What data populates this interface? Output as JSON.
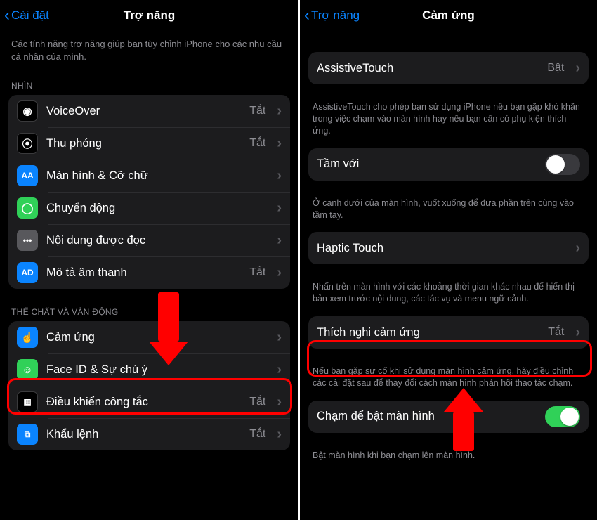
{
  "colors": {
    "accent": "#0a84ff",
    "highlight": "#ff0000",
    "switch_on": "#30d158"
  },
  "left": {
    "back_label": "Cài đặt",
    "title": "Trợ năng",
    "intro": "Các tính năng trợ năng giúp bạn tùy chỉnh iPhone cho các nhu cầu cá nhân của mình.",
    "sections": {
      "vision": {
        "header": "NHÌN",
        "items": [
          {
            "icon_name": "voiceover-icon",
            "icon_glyph": "◉",
            "icon_bg": "bg-black",
            "label": "VoiceOver",
            "value": "Tắt"
          },
          {
            "icon_name": "zoom-icon",
            "icon_glyph": "⦿",
            "icon_bg": "bg-black",
            "label": "Thu phóng",
            "value": "Tắt"
          },
          {
            "icon_name": "text-size-icon",
            "icon_glyph": "AA",
            "icon_bg": "bg-blue",
            "label": "Màn hình & Cỡ chữ",
            "value": ""
          },
          {
            "icon_name": "motion-icon",
            "icon_glyph": "◯",
            "icon_bg": "bg-green",
            "label": "Chuyển động",
            "value": ""
          },
          {
            "icon_name": "spoken-content-icon",
            "icon_glyph": "💬",
            "icon_bg": "bg-grey",
            "label": "Nội dung được đọc",
            "value": ""
          },
          {
            "icon_name": "audio-desc-icon",
            "icon_glyph": "▶",
            "icon_bg": "bg-blue2",
            "label": "Mô tả âm thanh",
            "value": "Tắt"
          }
        ]
      },
      "motor": {
        "header": "THỂ CHẤT VÀ VẬN ĐỘNG",
        "items": [
          {
            "icon_name": "touch-icon",
            "icon_glyph": "☝",
            "icon_bg": "bg-blue",
            "label": "Cảm ứng",
            "value": ""
          },
          {
            "icon_name": "faceid-icon",
            "icon_glyph": "☺",
            "icon_bg": "bg-green",
            "label": "Face ID & Sự chú ý",
            "value": ""
          },
          {
            "icon_name": "switch-control-icon",
            "icon_glyph": "▦",
            "icon_bg": "bg-black",
            "label": "Điều khiển công tắc",
            "value": "Tắt"
          },
          {
            "icon_name": "voice-control-icon",
            "icon_glyph": "⧉",
            "icon_bg": "bg-blue",
            "label": "Khẩu lệnh",
            "value": "Tắt"
          }
        ]
      }
    }
  },
  "right": {
    "back_label": "Trợ năng",
    "title": "Cảm ứng",
    "groups": [
      {
        "items": [
          {
            "label": "AssistiveTouch",
            "value": "Bật",
            "type": "nav"
          }
        ],
        "footer": "AssistiveTouch cho phép bạn sử dụng iPhone nếu bạn gặp khó khăn trong việc chạm vào màn hình hay nếu bạn cần có phụ kiện thích ứng."
      },
      {
        "items": [
          {
            "label": "Tầm với",
            "type": "switch",
            "state": "off"
          }
        ],
        "footer": "Ở cạnh dưới của màn hình, vuốt xuống để đưa phần trên cùng vào tầm tay."
      },
      {
        "items": [
          {
            "label": "Haptic Touch",
            "value": "",
            "type": "nav"
          }
        ],
        "footer": "Nhấn trên màn hình với các khoảng thời gian khác nhau để hiển thị bản xem trước nội dung, các tác vụ và menu ngữ cảnh."
      },
      {
        "items": [
          {
            "label": "Thích nghi cảm ứng",
            "value": "Tắt",
            "type": "nav"
          }
        ],
        "footer": "Nếu bạn gặp sự cố khi sử dụng màn hình cảm ứng, hãy điều chỉnh các cài đặt sau để thay đổi cách màn hình phản hồi thao tác chạm."
      },
      {
        "items": [
          {
            "label": "Chạm để bật màn hình",
            "type": "switch",
            "state": "on"
          }
        ],
        "footer": "Bật màn hình khi bạn chạm lên màn hình."
      }
    ]
  }
}
